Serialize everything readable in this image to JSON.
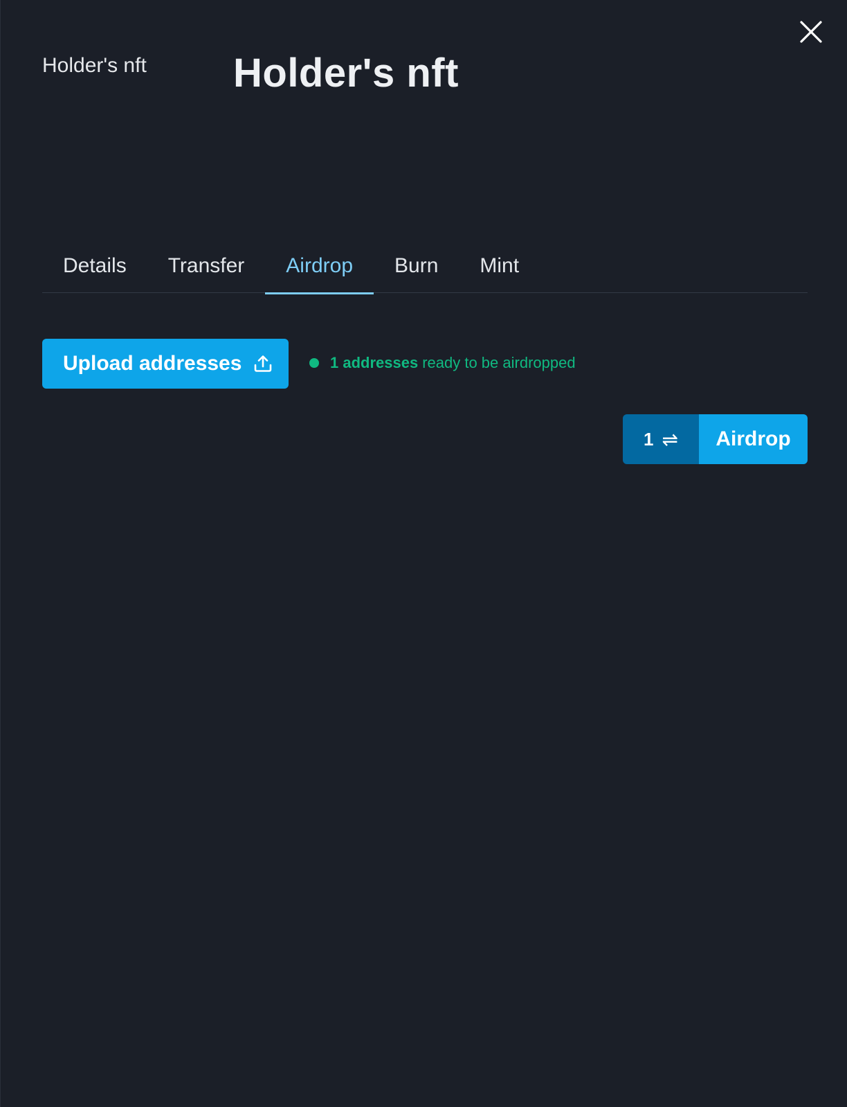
{
  "header": {
    "small_title": "Holder's nft",
    "big_title": "Holder's nft"
  },
  "tabs": [
    {
      "label": "Details",
      "active": false
    },
    {
      "label": "Transfer",
      "active": false
    },
    {
      "label": "Airdrop",
      "active": true
    },
    {
      "label": "Burn",
      "active": false
    },
    {
      "label": "Mint",
      "active": false
    }
  ],
  "airdrop": {
    "upload_label": "Upload addresses",
    "status_count": "1 addresses",
    "status_text": "ready to be airdropped",
    "quantity": "1",
    "swap_icon": "⇌",
    "airdrop_label": "Airdrop"
  },
  "colors": {
    "accent": "#0ea5e9",
    "accent_dark": "#0369a1",
    "active_tab": "#7ecdf5",
    "success": "#10b981",
    "background": "#1b1f28"
  },
  "icons": {
    "close": "close-icon",
    "upload": "upload-icon",
    "swap": "swap-icon"
  }
}
